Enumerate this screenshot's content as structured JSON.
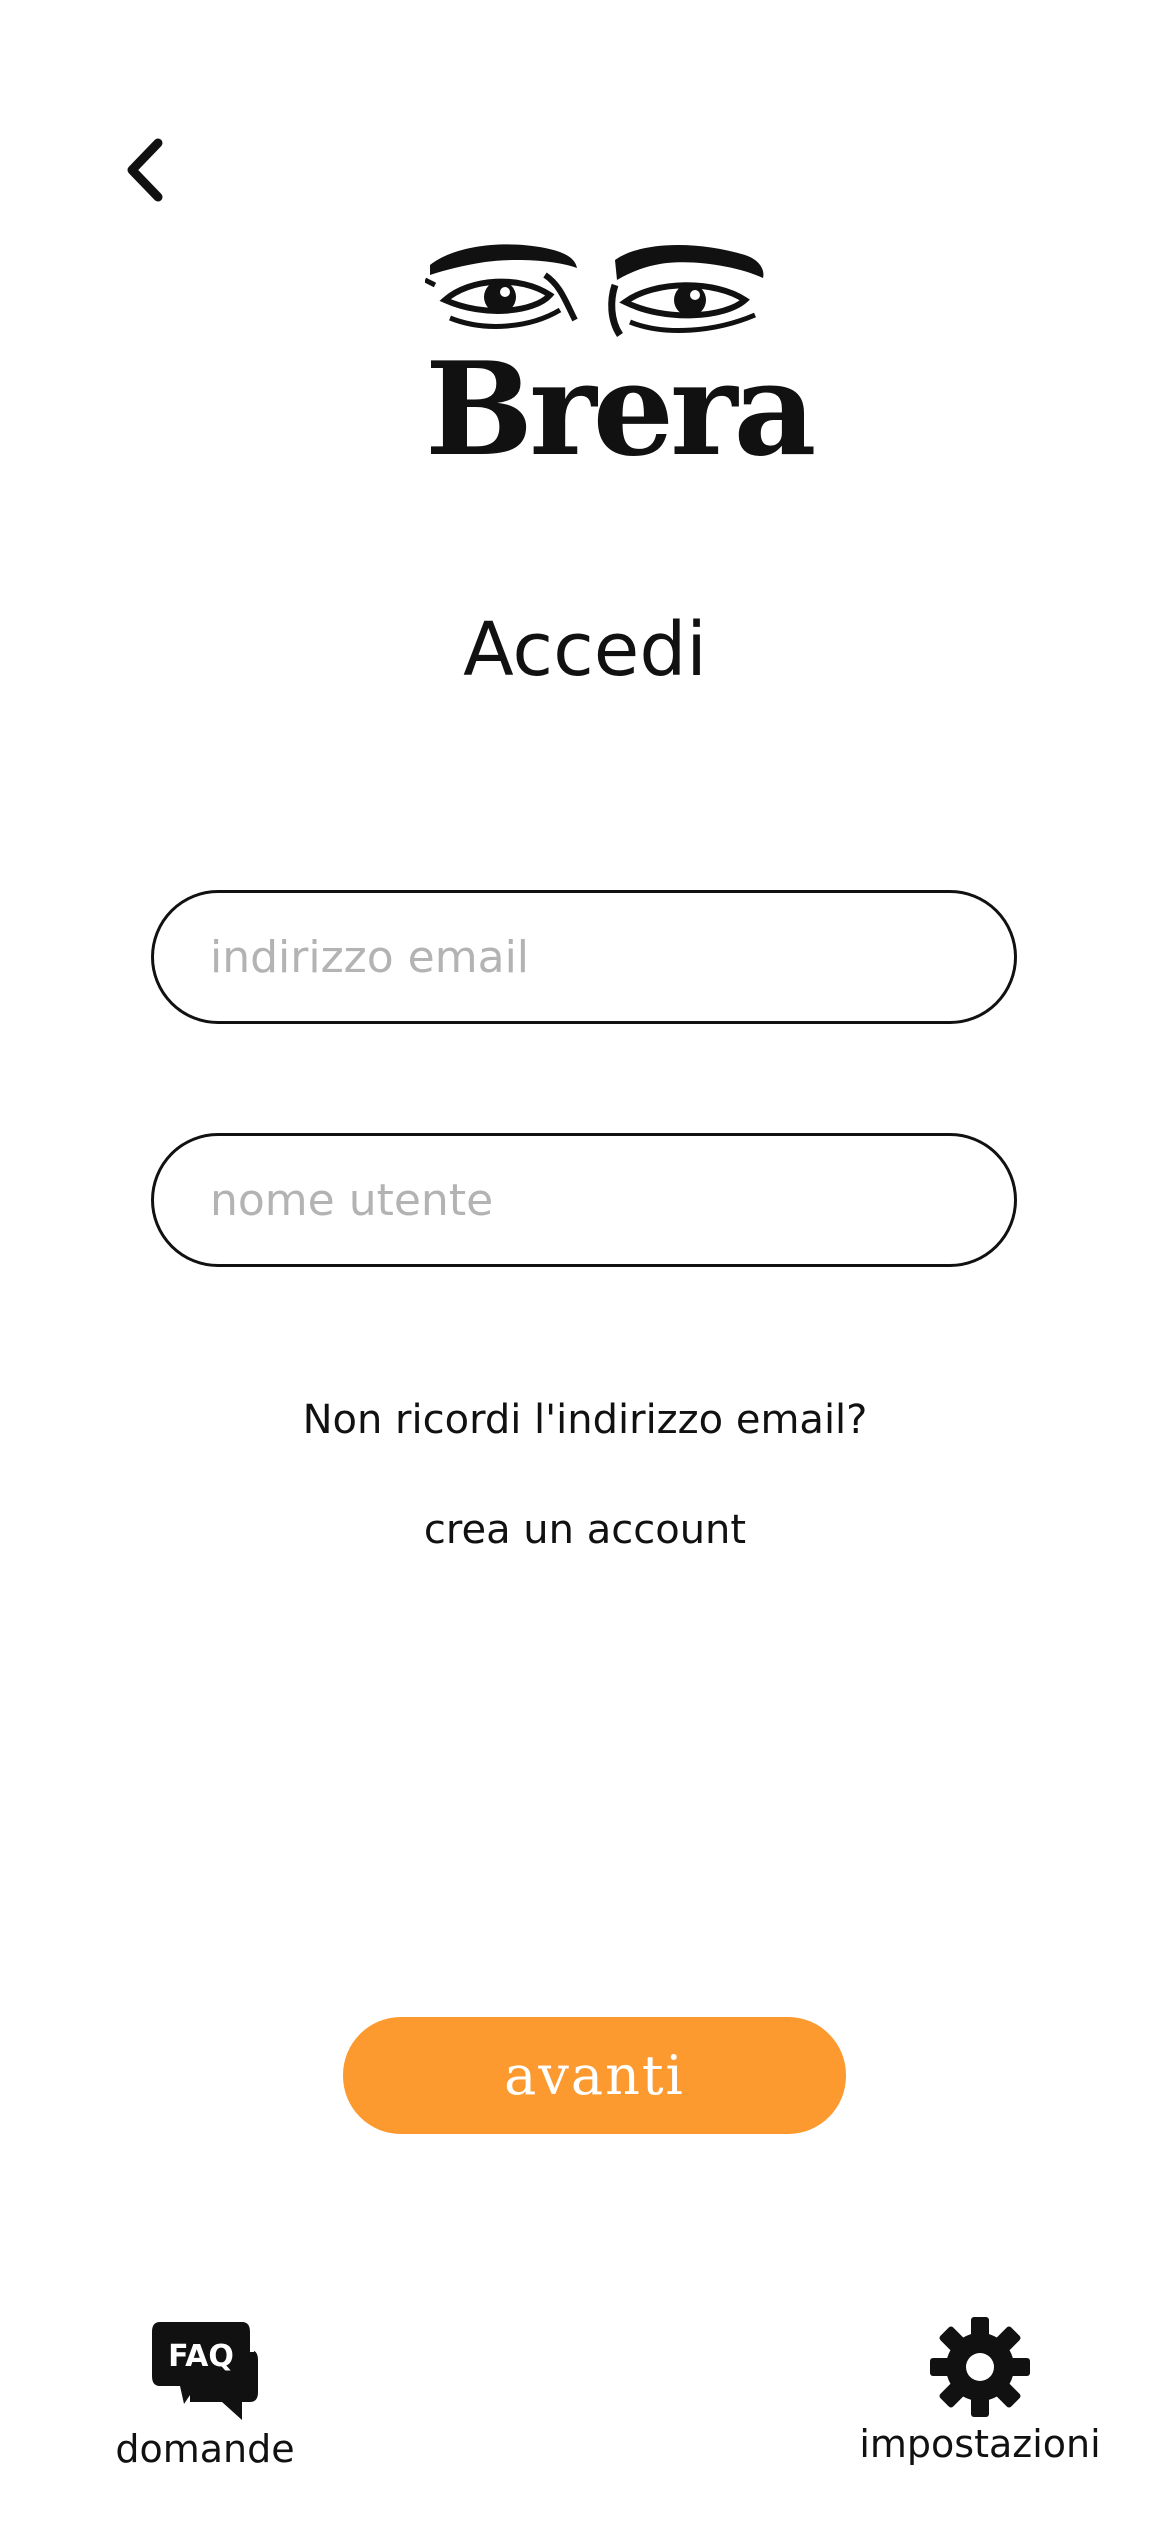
{
  "brand": {
    "name": "Brera"
  },
  "page": {
    "title": "Accedi"
  },
  "form": {
    "email_placeholder": "indirizzo email",
    "email_value": "",
    "username_placeholder": "nome utente",
    "username_value": "",
    "forgot_email_link": "Non ricordi l'indirizzo email?",
    "create_account_link": "crea un account",
    "submit_label": "avanti"
  },
  "bottom_nav": {
    "faq": {
      "icon": "faq-chat-bubbles-icon",
      "icon_text": "FAQ",
      "label": "domande"
    },
    "settings": {
      "icon": "gear-icon",
      "label": "impostazioni"
    }
  },
  "colors": {
    "accent": "#FD9A2F",
    "text": "#111111",
    "placeholder": "#B3B3B3",
    "background": "#FFFFFF"
  }
}
